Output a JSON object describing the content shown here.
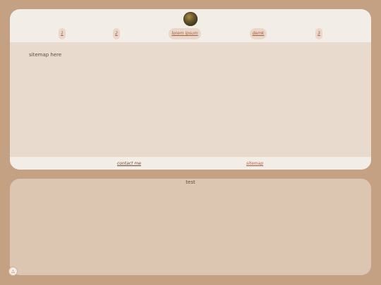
{
  "header": {
    "avatar_icon": "avatar-photo"
  },
  "nav": {
    "items": [
      {
        "label": "1"
      },
      {
        "label": "2"
      },
      {
        "label": "lorem ipsum"
      },
      {
        "label": "demk"
      },
      {
        "label": "3"
      }
    ]
  },
  "main": {
    "text": "sitemap here"
  },
  "footer": {
    "links": [
      {
        "label": "contact me"
      },
      {
        "label": "sitemap"
      }
    ]
  },
  "panel": {
    "text": "test"
  },
  "controls": {
    "up_icon": "triangle-up-icon",
    "up_glyph": "△"
  },
  "colors": {
    "accent": "#b05a3c",
    "background": "#c4a183",
    "window": "#f3ede7",
    "content": "#e8dacc",
    "panel": "#dcc6b2"
  }
}
